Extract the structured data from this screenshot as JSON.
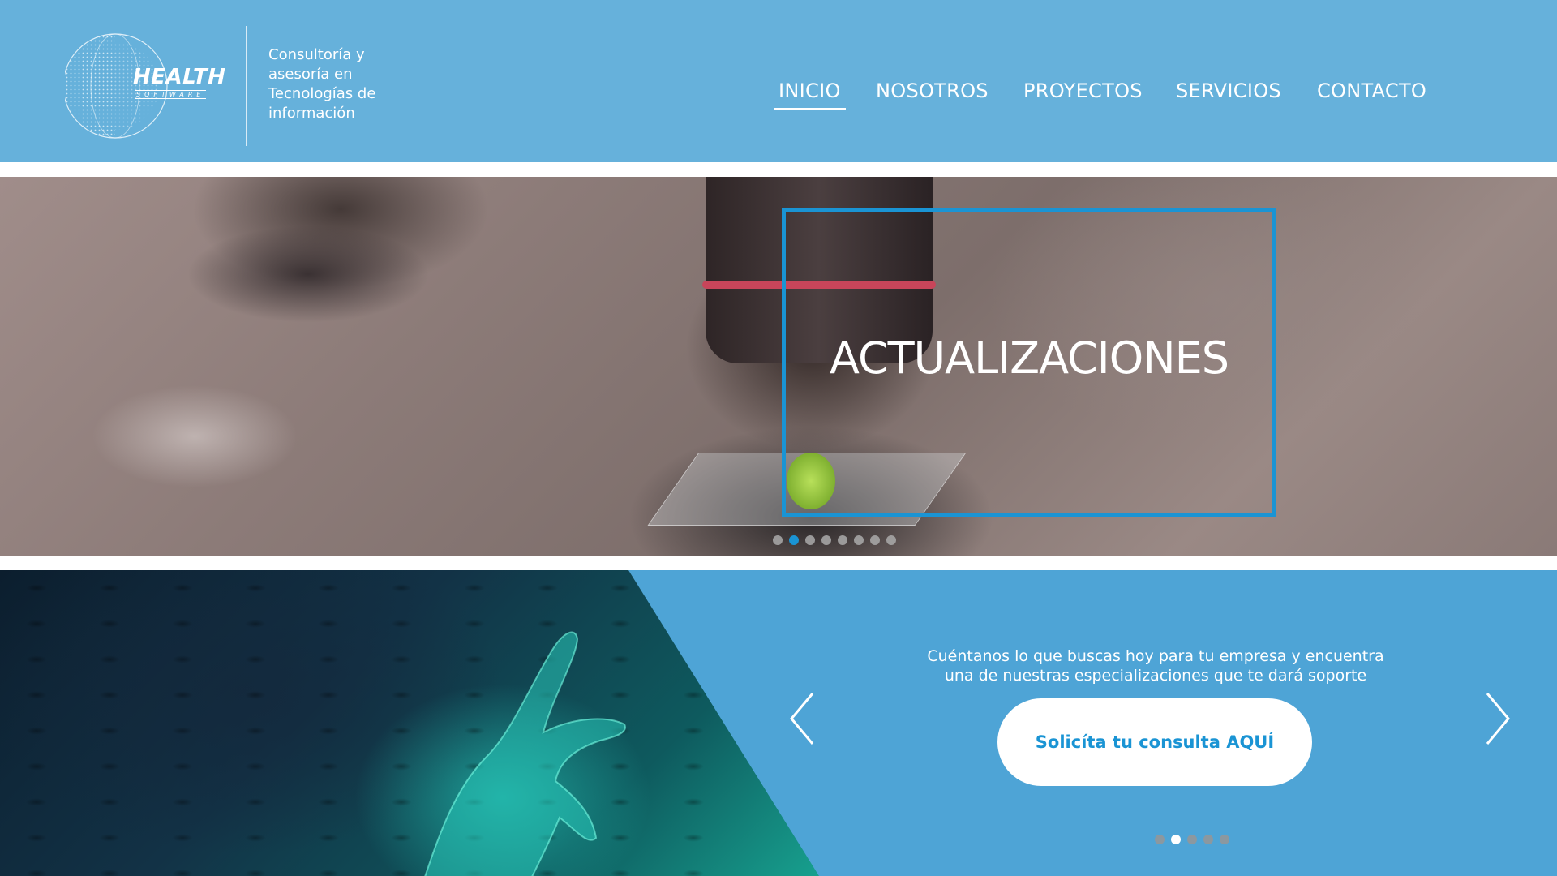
{
  "header": {
    "logo_main": "HEALTH",
    "logo_sub": "SOFTWARE",
    "tagline_lines": [
      "Consultoría y",
      "asesoría en",
      "Tecnologías de",
      "información"
    ]
  },
  "nav": {
    "items": [
      {
        "label": "INICIO",
        "active": true
      },
      {
        "label": "NOSOTROS",
        "active": false
      },
      {
        "label": "PROYECTOS",
        "active": false
      },
      {
        "label": "SERVICIOS",
        "active": false
      },
      {
        "label": "CONTACTO",
        "active": false
      }
    ]
  },
  "hero": {
    "title": "ACTUALIZACIONES",
    "slide_count": 8,
    "active_slide": 2
  },
  "cta": {
    "text_line1": "Cuéntanos lo que buscas hoy para tu empresa y encuentra",
    "text_line2": "una de nuestras especializaciones que te dará soporte",
    "button_label": "Solicíta tu consulta AQUÍ",
    "slide_count": 5,
    "active_slide": 2,
    "prev_icon": "chevron-left-icon",
    "next_icon": "chevron-right-icon"
  },
  "colors": {
    "header_bg": "#66b1db",
    "accent": "#1a94d4",
    "cta_bg": "#4ea4d6"
  }
}
